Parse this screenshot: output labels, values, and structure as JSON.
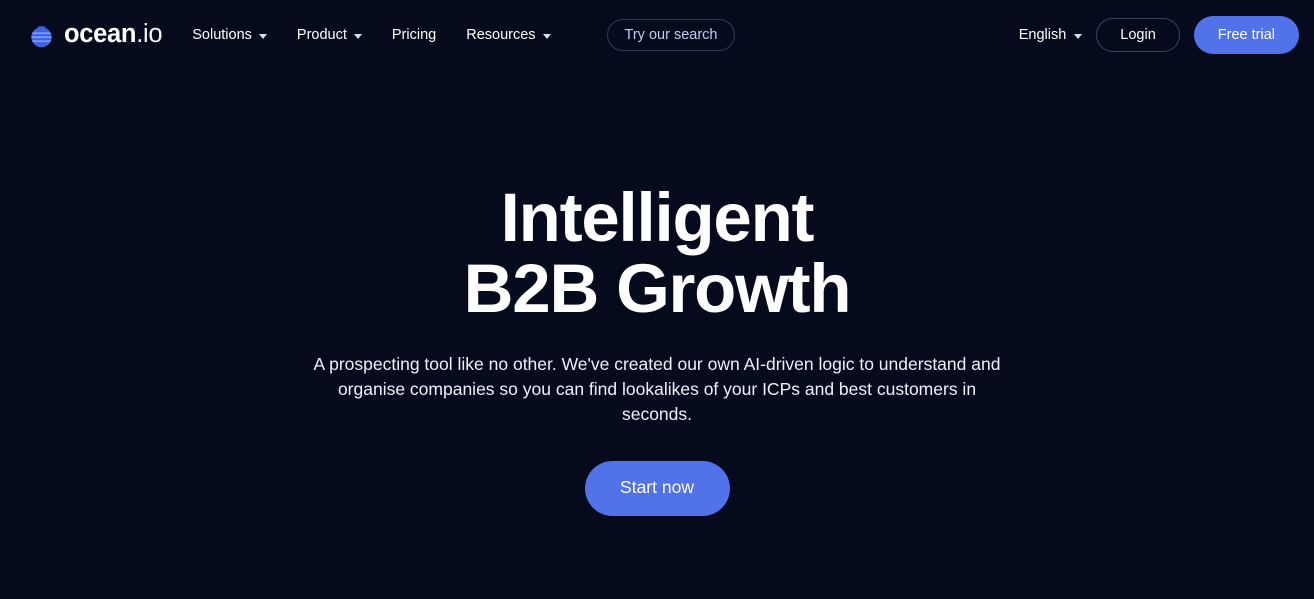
{
  "theme": {
    "background": "#050a1c",
    "accent": "#5172e8",
    "text": "#ffffff",
    "muted_text": "#c3cdf2",
    "border": "#323a57"
  },
  "header": {
    "logo": {
      "icon": "ocean-globe-icon",
      "word_primary": "ocean",
      "word_secondary": ".io",
      "full": "ocean.io"
    },
    "nav": [
      {
        "label": "Solutions",
        "has_dropdown": true
      },
      {
        "label": "Product",
        "has_dropdown": true
      },
      {
        "label": "Pricing",
        "has_dropdown": false
      },
      {
        "label": "Resources",
        "has_dropdown": true
      }
    ],
    "search_button": "Try our search",
    "language": {
      "label": "English",
      "has_dropdown": true
    },
    "login_button": "Login",
    "trial_button": "Free trial"
  },
  "hero": {
    "title_line_1": "Intelligent B2B",
    "title_line_2": "Growth",
    "subtitle": "A prospecting tool like no other. We've created our own AI-driven logic to understand and organise companies so you can find lookalikes of your ICPs and best customers in seconds.",
    "cta_button": "Start now"
  }
}
